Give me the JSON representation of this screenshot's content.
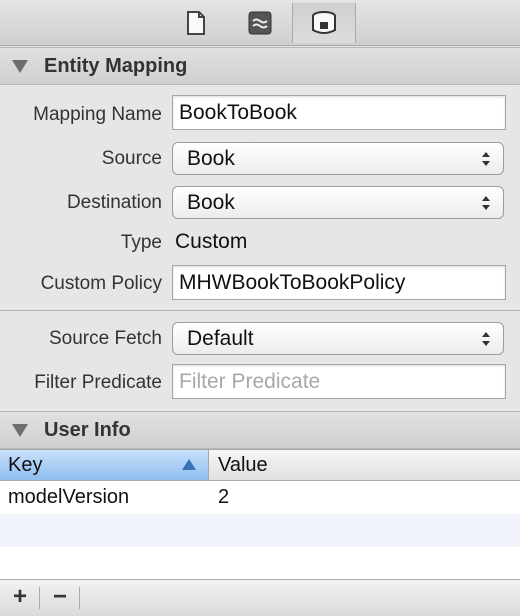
{
  "toolbar": {
    "tabs": [
      {
        "icon": "file-inspector-icon"
      },
      {
        "icon": "quick-help-icon"
      },
      {
        "icon": "data-model-inspector-icon",
        "selected": true
      }
    ]
  },
  "entity_mapping": {
    "section_title": "Entity Mapping",
    "mapping_name": {
      "label": "Mapping Name",
      "value": "BookToBook"
    },
    "source": {
      "label": "Source",
      "value": "Book"
    },
    "destination": {
      "label": "Destination",
      "value": "Book"
    },
    "type": {
      "label": "Type",
      "value": "Custom"
    },
    "custom_policy": {
      "label": "Custom Policy",
      "value": "MHWBookToBookPolicy"
    },
    "source_fetch": {
      "label": "Source Fetch",
      "value": "Default"
    },
    "filter_predicate": {
      "label": "Filter Predicate",
      "placeholder": "Filter Predicate"
    }
  },
  "user_info": {
    "section_title": "User Info",
    "columns": {
      "key": "Key",
      "value": "Value"
    },
    "rows": [
      {
        "key": "modelVersion",
        "value": "2"
      }
    ]
  },
  "bottom_bar": {
    "add_label": "+",
    "remove_label": "−"
  },
  "colors": {
    "header_selected": "#8fbef0",
    "panel_background": "#e6e6e6"
  }
}
